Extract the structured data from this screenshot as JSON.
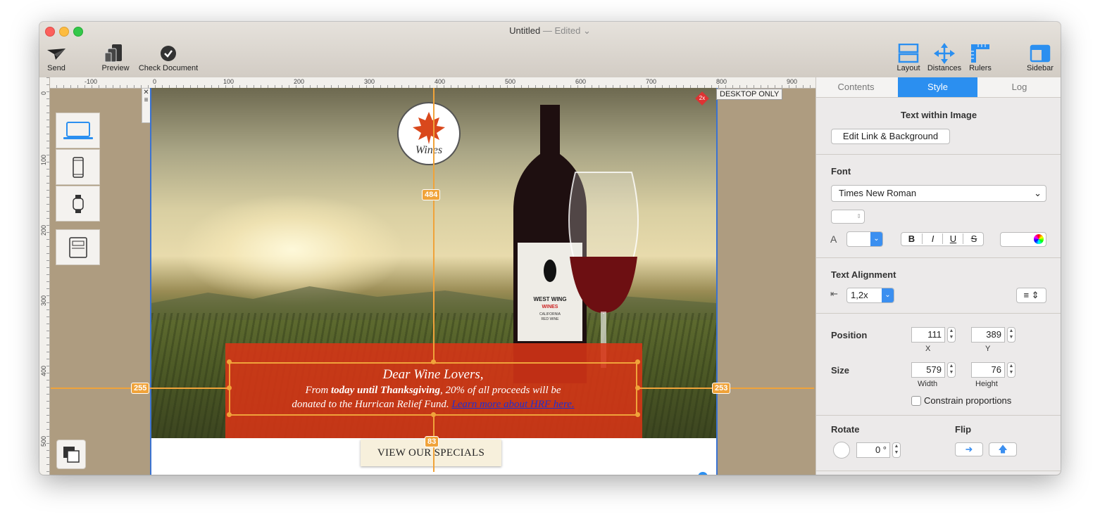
{
  "window": {
    "title": "Untitled",
    "status": "— Edited"
  },
  "toolbar": {
    "send": "Send",
    "preview": "Preview",
    "check": "Check Document",
    "layout": "Layout",
    "distances": "Distances",
    "rulers": "Rulers",
    "sidebar": "Sidebar"
  },
  "ruler": {
    "h": [
      "-100",
      "0",
      "100",
      "200",
      "300",
      "400",
      "500",
      "600",
      "700",
      "800",
      "900"
    ],
    "v": [
      "0",
      "100",
      "200",
      "300",
      "400",
      "500"
    ]
  },
  "canvas": {
    "badge": "2x",
    "desktop_only": "DESKTOP ONLY",
    "logo_word": "Wines",
    "msg_line1": "Dear Wine Lovers,",
    "msg_line2_pre": "From ",
    "msg_line2_bold": "today until Thanksgiving",
    "msg_line2_post": ", 20% of all proceeds will be",
    "msg_line3": "donated to the Hurrican Relief Fund. ",
    "msg_link": "Learn more about HRF here.",
    "cta": "VIEW OUR SPECIALS",
    "dist_top": "484",
    "dist_left": "255",
    "dist_right": "253",
    "dist_bottom": "83",
    "bottle_label1": "WEST WING",
    "bottle_label2": "WINES",
    "bottle_label3": "CALIFORNIA",
    "bottle_label4": "RED WINE"
  },
  "sidebar": {
    "tabs": [
      "Contents",
      "Style",
      "Log"
    ],
    "active_tab": "Style",
    "section_title": "Text within Image",
    "edit_link": "Edit Link & Background",
    "font_label": "Font",
    "font_value": "Times New Roman",
    "bold": "B",
    "italic": "I",
    "underline": "U",
    "strike": "S",
    "align_label": "Text Alignment",
    "line_height": "1,2x",
    "position_label": "Position",
    "pos_x": "111",
    "pos_y": "389",
    "x_label": "X",
    "y_label": "Y",
    "size_label": "Size",
    "width": "579",
    "height": "76",
    "w_label": "Width",
    "h_label": "Height",
    "constrain": "Constrain proportions",
    "rotate_label": "Rotate",
    "flip_label": "Flip",
    "rotate_value": "0 °"
  },
  "colors": {
    "accent": "#2b8ff0",
    "guide": "#f0a33a",
    "banner": "#d73416"
  }
}
